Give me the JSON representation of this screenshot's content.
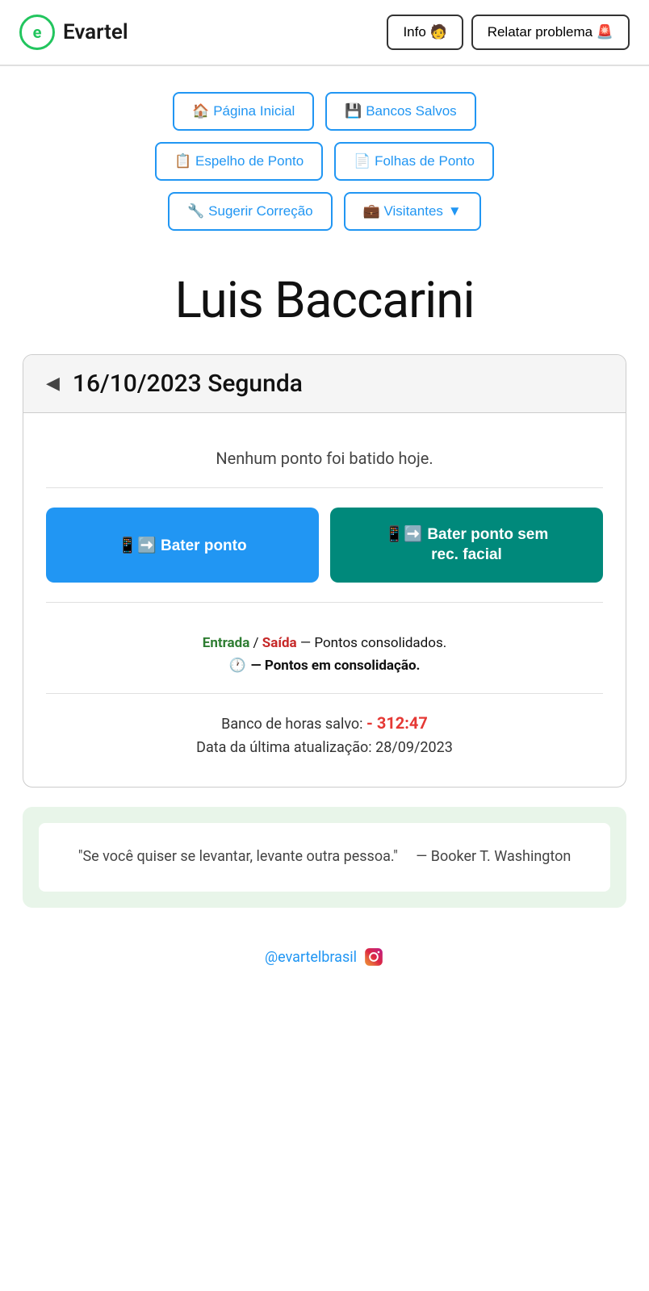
{
  "header": {
    "logo_letter": "e",
    "brand_name": "Evartel",
    "info_button": "Info 🧑",
    "report_button": "Relatar problema 🚨"
  },
  "nav": {
    "pagina_inicial": "🏠 Página Inicial",
    "bancos_salvos": "💾 Bancos Salvos",
    "espelho_de_ponto": "📋 Espelho de Ponto",
    "folhas_de_ponto": "📄 Folhas de Ponto",
    "sugerir_correcao": "🔧 Sugerir Correção",
    "visitantes": "💼 Visitantes",
    "visitantes_arrow": "▼"
  },
  "user": {
    "name": "Luis Baccarini"
  },
  "card": {
    "arrow_left": "◀",
    "date": "16/10/2023 Segunda",
    "no_ponto_msg": "Nenhum ponto foi batido hoje.",
    "bater_ponto_label": "📱➡️ Bater ponto",
    "bater_ponto_sem_label_line1": "📱➡️ Bater ponto sem",
    "bater_ponto_sem_label_line2": "rec. facial",
    "legend_entrada": "Entrada",
    "legend_separador": " / ",
    "legend_saida": "Saída",
    "legend_consolidated": "— Pontos consolidados.",
    "legend_clock": "🕐",
    "legend_consolidating": "— Pontos em consolidação.",
    "banco_label": "Banco de horas salvo: ",
    "banco_value": "- 312:47",
    "ultima_atualizacao": "Data da última atualização: 28/09/2023"
  },
  "quote": {
    "text": "\"Se você quiser se levantar, levante outra pessoa.\"",
    "author": "— Booker T. Washington"
  },
  "footer": {
    "instagram_handle": "@evartelbrasil"
  }
}
